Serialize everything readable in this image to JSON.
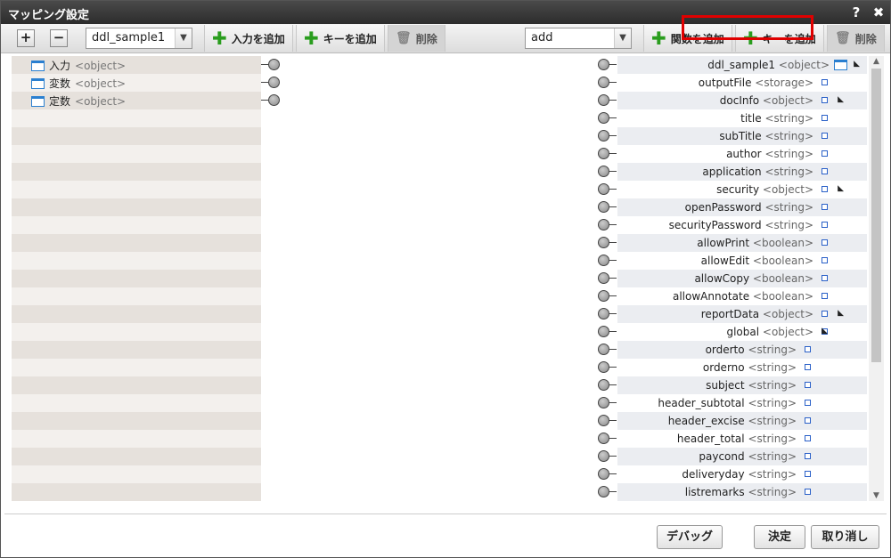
{
  "dialog": {
    "title": "マッピング設定",
    "help": "?",
    "close": "✖"
  },
  "toolbar": {
    "expand": "+",
    "collapse": "−",
    "source_select": "ddl_sample1",
    "add_input": "入力を追加",
    "add_key_left": "キーを追加",
    "delete_left": "削除",
    "target_select": "add",
    "add_function": "関数を追加",
    "add_key_right": "キーを追加",
    "delete_right": "削除"
  },
  "left_nodes": [
    {
      "name": "入力",
      "type": "<object>"
    },
    {
      "name": "変数",
      "type": "<object>"
    },
    {
      "name": "定数",
      "type": "<object>"
    }
  ],
  "right_nodes": [
    {
      "name": "ddl_sample1",
      "type": "<object>",
      "level": 0,
      "icon": "box-icon",
      "expandable": true
    },
    {
      "name": "outputFile",
      "type": "<storage>",
      "level": 1,
      "expandable": false
    },
    {
      "name": "docInfo",
      "type": "<object>",
      "level": 1,
      "expandable": true
    },
    {
      "name": "title",
      "type": "<string>",
      "level": 2,
      "expandable": false
    },
    {
      "name": "subTitle",
      "type": "<string>",
      "level": 2,
      "expandable": false
    },
    {
      "name": "author",
      "type": "<string>",
      "level": 2,
      "expandable": false
    },
    {
      "name": "application",
      "type": "<string>",
      "level": 2,
      "expandable": false
    },
    {
      "name": "security",
      "type": "<object>",
      "level": 1,
      "expandable": true
    },
    {
      "name": "openPassword",
      "type": "<string>",
      "level": 2,
      "expandable": false
    },
    {
      "name": "securityPassword",
      "type": "<string>",
      "level": 2,
      "expandable": false
    },
    {
      "name": "allowPrint",
      "type": "<boolean>",
      "level": 2,
      "expandable": false
    },
    {
      "name": "allowEdit",
      "type": "<boolean>",
      "level": 2,
      "expandable": false
    },
    {
      "name": "allowCopy",
      "type": "<boolean>",
      "level": 2,
      "expandable": false
    },
    {
      "name": "allowAnnotate",
      "type": "<boolean>",
      "level": 2,
      "expandable": false
    },
    {
      "name": "reportData",
      "type": "<object>",
      "level": 1,
      "expandable": true
    },
    {
      "name": "global",
      "type": "<object>",
      "level": 2,
      "expandable": true
    },
    {
      "name": "orderto",
      "type": "<string>",
      "level": 3,
      "expandable": false
    },
    {
      "name": "orderno",
      "type": "<string>",
      "level": 3,
      "expandable": false
    },
    {
      "name": "subject",
      "type": "<string>",
      "level": 3,
      "expandable": false
    },
    {
      "name": "header_subtotal",
      "type": "<string>",
      "level": 3,
      "expandable": false
    },
    {
      "name": "header_excise",
      "type": "<string>",
      "level": 3,
      "expandable": false
    },
    {
      "name": "header_total",
      "type": "<string>",
      "level": 3,
      "expandable": false
    },
    {
      "name": "paycond",
      "type": "<string>",
      "level": 3,
      "expandable": false
    },
    {
      "name": "deliveryday",
      "type": "<string>",
      "level": 3,
      "expandable": false
    },
    {
      "name": "listremarks",
      "type": "<string>",
      "level": 3,
      "expandable": false
    }
  ],
  "footer": {
    "debug": "デバッグ",
    "ok": "決定",
    "cancel": "取り消し"
  },
  "colors": {
    "row_alt_left": "#e6e1dc",
    "row_left": "#f3f0ed",
    "row_right": "#ebedf1",
    "highlight": "#e00000",
    "add_icon": "#2a9d1e"
  }
}
